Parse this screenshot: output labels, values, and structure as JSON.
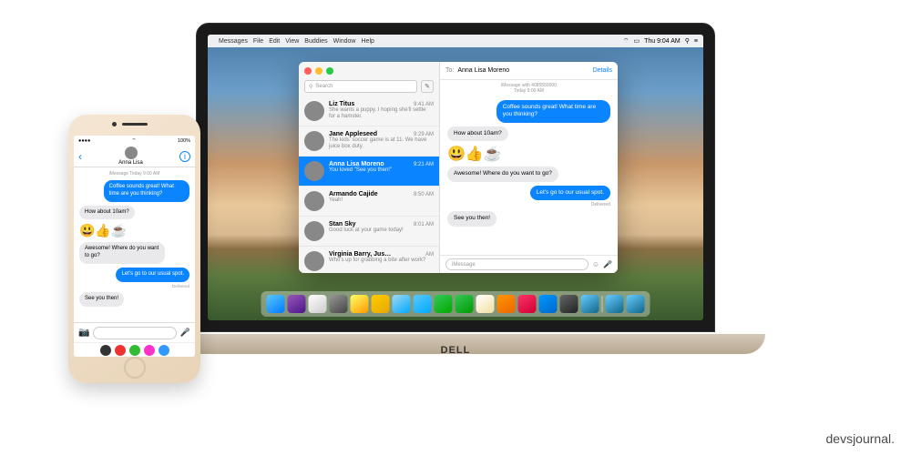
{
  "watermark": "devsjournal.",
  "laptop_brand": "DELL",
  "menubar": {
    "app": "Messages",
    "items": [
      "File",
      "Edit",
      "View",
      "Buddies",
      "Window",
      "Help"
    ],
    "clock": "Thu 9:04 AM"
  },
  "messages_app": {
    "search_placeholder": "Search",
    "conversations": [
      {
        "name": "Liz Titus",
        "time": "9:41 AM",
        "preview": "She wants a puppy. I hoping she'll settle for a hamster."
      },
      {
        "name": "Jane Appleseed",
        "time": "9:29 AM",
        "preview": "The kids' soccer game is at 11. We have juice box duty."
      },
      {
        "name": "Anna Lisa Moreno",
        "time": "9:21 AM",
        "preview": "You loved \"See you then!\"",
        "selected": true
      },
      {
        "name": "Armando Cajide",
        "time": "8:50 AM",
        "preview": "Yeah!"
      },
      {
        "name": "Stan Sky",
        "time": "8:01 AM",
        "preview": "Good luck at your game today!"
      },
      {
        "name": "Virginia Barry, Jus…",
        "time": "AM",
        "preview": "Who's up for grabbing a bite after work?"
      }
    ],
    "chat": {
      "to_label": "To:",
      "recipient": "Anna Lisa Moreno",
      "details": "Details",
      "subtitle_line1": "iMessage with 4085550000",
      "subtitle_line2": "Today 9:00 AM",
      "bubbles": [
        {
          "kind": "sent",
          "text": "Coffee sounds great! What time are you thinking?"
        },
        {
          "kind": "rcvd",
          "text": "How about 10am?"
        },
        {
          "kind": "emoji",
          "text": "😃👍☕"
        },
        {
          "kind": "rcvd",
          "text": "Awesome! Where do you want to go?"
        },
        {
          "kind": "sent",
          "text": "Let's go to our usual spot."
        },
        {
          "kind": "delivered",
          "text": "Delivered"
        },
        {
          "kind": "rcvd",
          "text": "See you then!"
        }
      ],
      "input_placeholder": "iMessage"
    }
  },
  "phone": {
    "status": {
      "carrier": "●●●●",
      "time": "",
      "battery": "100%"
    },
    "contact_name": "Anna Lisa",
    "subtitle": "iMessage Today 9:00 AM",
    "bubbles": [
      {
        "kind": "sent",
        "text": "Coffee sounds great! What time are you thinking?"
      },
      {
        "kind": "rcvd",
        "text": "How about 10am?"
      },
      {
        "kind": "emoji",
        "text": "😃👍☕"
      },
      {
        "kind": "rcvd",
        "text": "Awesome! Where do you want to go?"
      },
      {
        "kind": "sent",
        "text": "Let's go to our usual spot."
      },
      {
        "kind": "delivered",
        "text": "Delivered"
      },
      {
        "kind": "rcvd",
        "text": "See you then!"
      }
    ]
  }
}
